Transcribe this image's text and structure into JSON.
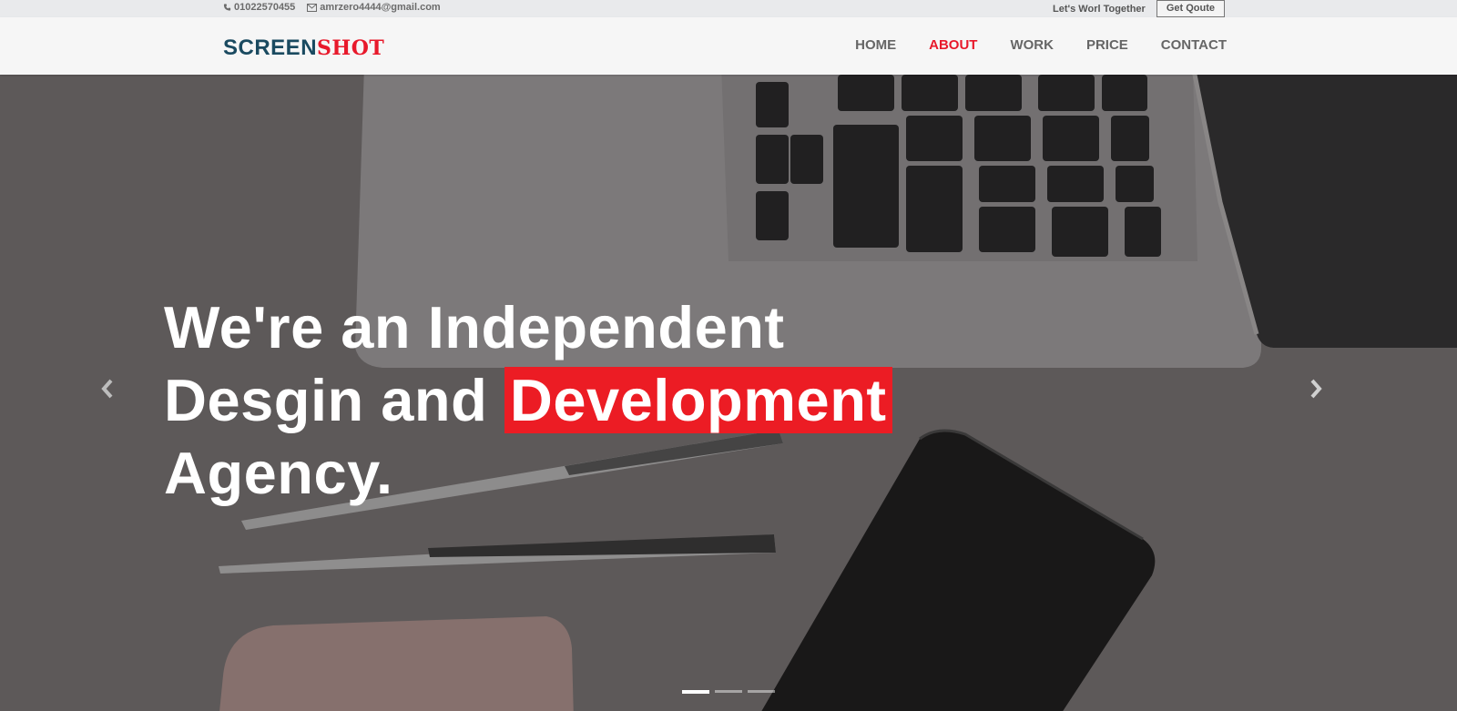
{
  "topbar": {
    "phone": "01022570455",
    "email": "amrzero4444@gmail.com",
    "tagline": "Let's Worl Together",
    "cta": "Get Qoute"
  },
  "logo": {
    "part1": "SCREEN",
    "part2": "SHOT"
  },
  "nav": {
    "items": [
      {
        "label": "HOME"
      },
      {
        "label": "ABOUT"
      },
      {
        "label": "WORK"
      },
      {
        "label": "PRICE"
      },
      {
        "label": "CONTACT"
      }
    ],
    "active": "ABOUT"
  },
  "hero": {
    "line1": "We're an Independent",
    "line2_pre": "Desgin and ",
    "line2_highlight": "Development",
    "line3": "Agency.",
    "slide_count": 3,
    "active_slide": 1
  },
  "colors": {
    "accent": "#ec1c24",
    "brand": "#1a4a60"
  },
  "icons": [
    "phone-icon",
    "envelope-icon",
    "chevron-left-icon",
    "chevron-right-icon"
  ]
}
